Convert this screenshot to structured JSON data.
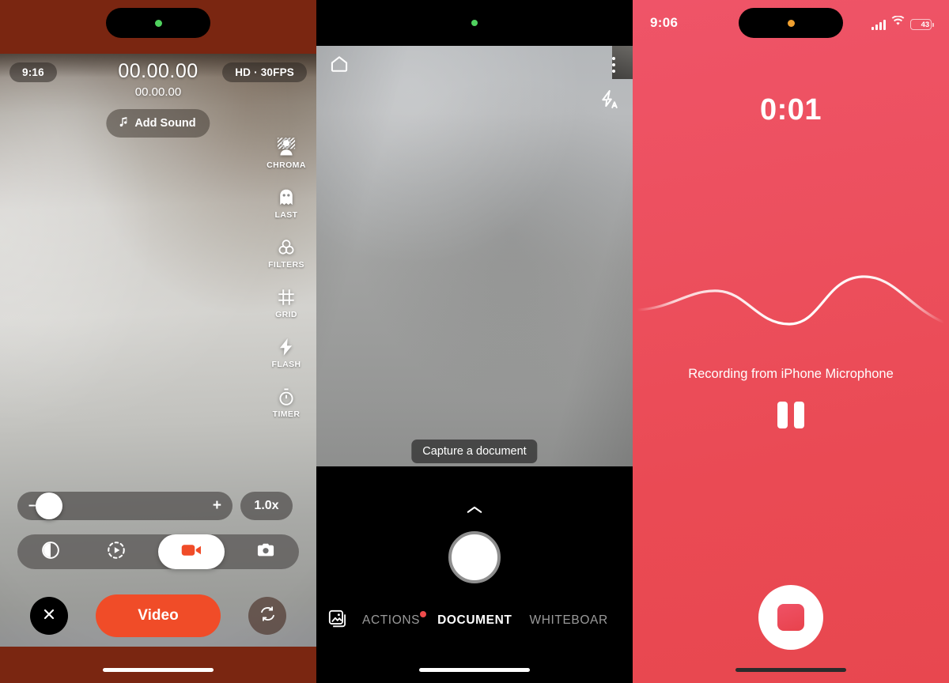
{
  "panels": {
    "video": {
      "status_time": "9:16",
      "quality_badge": "HD · 30FPS",
      "timer_main": "00.00.00",
      "timer_sub": "00.00.00",
      "add_sound_label": "Add Sound",
      "music_icon": "music-note-icon",
      "rail": [
        {
          "label": "CHROMA",
          "icon": "chroma-key-icon"
        },
        {
          "label": "LAST",
          "icon": "ghost-icon"
        },
        {
          "label": "FILTERS",
          "icon": "filters-icon"
        },
        {
          "label": "GRID",
          "icon": "grid-icon"
        },
        {
          "label": "FLASH",
          "icon": "flash-bolt-icon"
        },
        {
          "label": "TIMER",
          "icon": "stopwatch-icon"
        }
      ],
      "zoom": {
        "minus": "–",
        "plus": "+",
        "level": "1.0x"
      },
      "modes": [
        {
          "icon": "half-moon-icon",
          "active": false
        },
        {
          "icon": "slow-motion-icon",
          "active": false
        },
        {
          "icon": "video-camera-icon",
          "active": true
        },
        {
          "icon": "photo-camera-icon",
          "active": false
        }
      ],
      "cta_label": "Video",
      "close_icon": "close-x-icon",
      "flip_icon": "camera-flip-icon",
      "accent": "#f04c28",
      "frame_color": "#7a2611"
    },
    "document": {
      "home_icon": "home-icon",
      "more_icon": "more-vertical-icon",
      "flash_icon": "flash-auto-icon",
      "hint": "Capture a document",
      "chevron_icon": "chevron-up-icon",
      "shutter_icon": "shutter-button",
      "gallery_icon": "gallery-icon",
      "tabs": [
        {
          "label": "ACTIONS",
          "active": false,
          "badge": true
        },
        {
          "label": "DOCUMENT",
          "active": true,
          "badge": false
        },
        {
          "label": "WHITEBOAR",
          "active": false,
          "badge": false
        }
      ],
      "badge_color": "#ef4b4b"
    },
    "recorder": {
      "status_time": "9:06",
      "battery_level": "43",
      "signal_icon": "cellular-bars-icon",
      "wifi_icon": "wifi-icon",
      "timer": "0:01",
      "source_text": "Recording from iPhone Microphone",
      "pause_icon": "pause-icon",
      "stop_icon": "stop-icon",
      "waveform_icon": "audio-waveform",
      "background": "#ea4a54"
    }
  }
}
